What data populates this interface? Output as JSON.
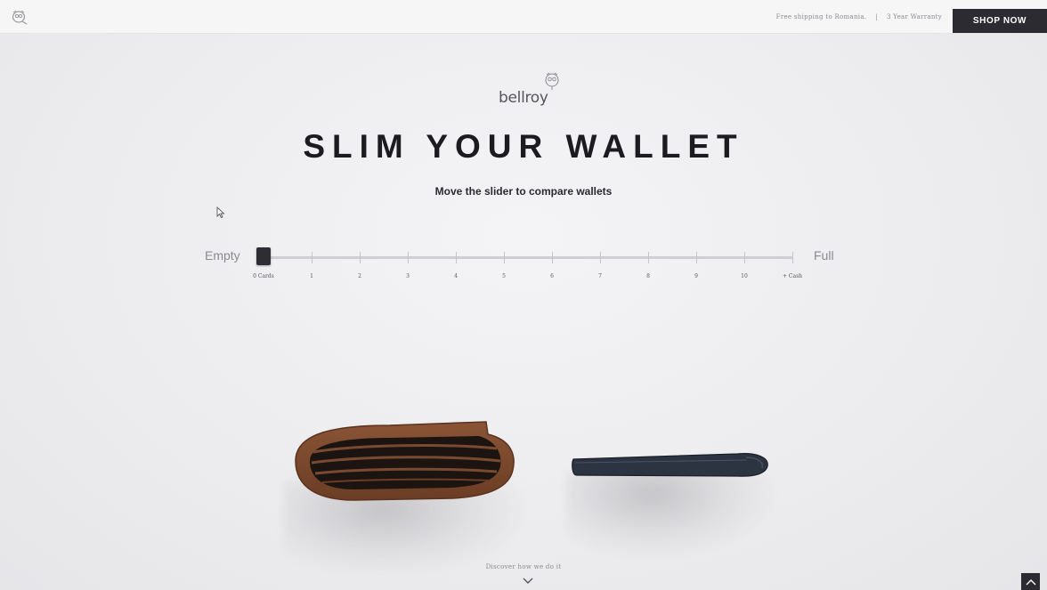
{
  "topbar": {
    "shipping_text": "Free shipping to Romania.",
    "separator": "|",
    "warranty_text": "3 Year Warranty",
    "shop_now_label": "SHOP NOW"
  },
  "brand": {
    "wordmark": "bellroy"
  },
  "hero": {
    "title": "SLIM YOUR WALLET",
    "subtitle": "Move the slider to compare wallets"
  },
  "slider": {
    "left_label": "Empty",
    "right_label": "Full",
    "ticks": [
      "0 Cards",
      "1",
      "2",
      "3",
      "4",
      "5",
      "6",
      "7",
      "8",
      "9",
      "10",
      "+ Cash"
    ],
    "selected_index": 0
  },
  "footer": {
    "discover_text": "Discover how we do it"
  },
  "colors": {
    "background": "#ececee",
    "dark_button": "#2b2b31",
    "title_text": "#1c1c20",
    "muted_text": "#8a8a90",
    "wallet_leather_brown": "#7a4a30",
    "wallet_slim_navy": "#2c3442"
  },
  "icons": {
    "top_logo": "bellroy-owl-icon",
    "cursor": "mouse-pointer-icon",
    "discover": "chevron-down-icon",
    "scroll_top": "chevron-up-icon"
  }
}
